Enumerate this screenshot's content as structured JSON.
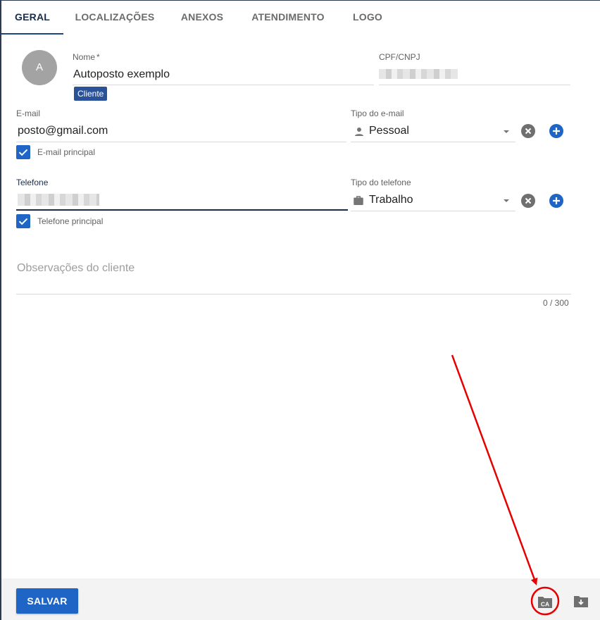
{
  "tabs": [
    {
      "label": "GERAL",
      "active": true
    },
    {
      "label": "LOCALIZAÇÕES",
      "active": false
    },
    {
      "label": "ANEXOS",
      "active": false
    },
    {
      "label": "ATENDIMENTO",
      "active": false
    },
    {
      "label": "LOGO",
      "active": false
    }
  ],
  "avatar": {
    "initial": "A"
  },
  "nome": {
    "label": "Nome",
    "required_mark": "*",
    "value": "Autoposto exemplo"
  },
  "cliente_badge": "Cliente",
  "cpf": {
    "label": "CPF/CNPJ"
  },
  "email": {
    "label": "E-mail",
    "value": "posto@gmail.com",
    "principal_label": "E-mail principal",
    "principal_checked": true
  },
  "tipo_email": {
    "label": "Tipo do e-mail",
    "value": "Pessoal",
    "icon": "person-icon"
  },
  "telefone": {
    "label": "Telefone",
    "principal_label": "Telefone principal",
    "principal_checked": true
  },
  "tipo_telefone": {
    "label": "Tipo do telefone",
    "value": "Trabalho",
    "icon": "briefcase-icon"
  },
  "observacoes": {
    "placeholder": "Observações do cliente",
    "counter": "0 / 300"
  },
  "footer": {
    "save_label": "SALVAR",
    "ca_icon_text": "CA"
  },
  "colors": {
    "primary": "#1f65c5",
    "tab_active": "#1a2c4a",
    "badge": "#2a5298",
    "annotation": "#e60000"
  }
}
